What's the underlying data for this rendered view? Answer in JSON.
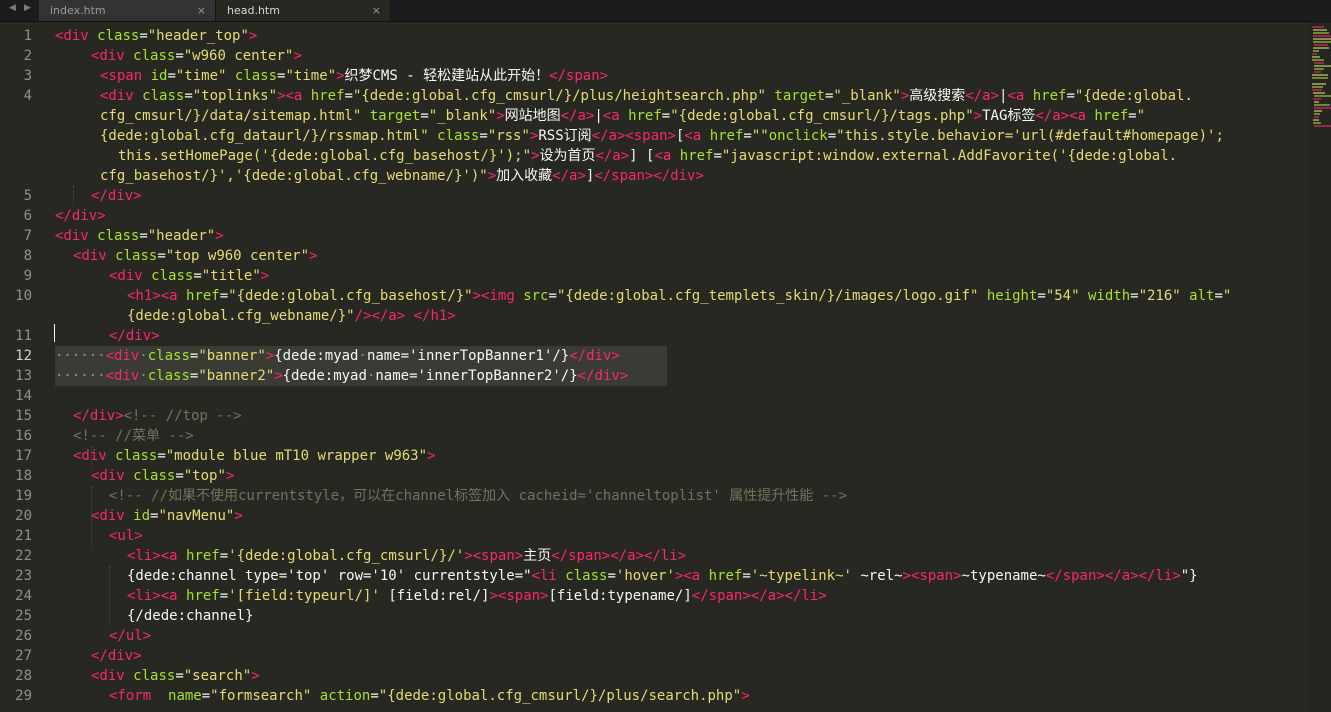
{
  "colors": {
    "background": "#272822",
    "tag": "#f92672",
    "attribute": "#a6e22e",
    "string": "#e6db74",
    "text": "#f8f8f2",
    "comment": "#75715e",
    "line_number": "#8f908a",
    "selection": "#3a3b34"
  },
  "tabbar": {
    "prev_icon": "triangle-left-icon",
    "next_icon": "triangle-right-icon",
    "tabs": [
      {
        "label": "index.htm",
        "close": "×",
        "active": false
      },
      {
        "label": "head.htm",
        "close": "×",
        "active": true
      }
    ]
  },
  "editor": {
    "current_line": 12,
    "rows": [
      {
        "n": "1",
        "segs": [
          [
            "t",
            "<div "
          ],
          [
            "a",
            "class"
          ],
          [
            "p",
            "="
          ],
          [
            "s",
            "\"header_top\""
          ],
          [
            "t",
            ">"
          ]
        ]
      },
      {
        "n": "2",
        "segs": [
          [
            "t",
            "<div "
          ],
          [
            "a",
            "class"
          ],
          [
            "p",
            "="
          ],
          [
            "s",
            "\"w960 center\""
          ],
          [
            "t",
            ">"
          ]
        ]
      },
      {
        "n": "3",
        "segs": [
          [
            "t",
            "<span "
          ],
          [
            "a",
            "id"
          ],
          [
            "p",
            "="
          ],
          [
            "s",
            "\"time\""
          ],
          [
            "p",
            " "
          ],
          [
            "a",
            "class"
          ],
          [
            "p",
            "="
          ],
          [
            "s",
            "\"time\""
          ],
          [
            "t",
            ">"
          ],
          [
            "p",
            "织梦CMS - 轻松建站从此开始！"
          ],
          [
            "t",
            "</span>"
          ]
        ]
      },
      {
        "n": "4",
        "segs": [
          [
            "t",
            "<div "
          ],
          [
            "a",
            "class"
          ],
          [
            "p",
            "="
          ],
          [
            "s",
            "\"toplinks\""
          ],
          [
            "t",
            ">"
          ],
          [
            "t",
            "<a "
          ],
          [
            "a",
            "href"
          ],
          [
            "p",
            "="
          ],
          [
            "s",
            "\"{dede:global.cfg_cmsurl/}/plus/heightsearch.php\""
          ],
          [
            "p",
            " "
          ],
          [
            "a",
            "target"
          ],
          [
            "p",
            "="
          ],
          [
            "s",
            "\"_blank\""
          ],
          [
            "t",
            ">"
          ],
          [
            "p",
            "高级搜索"
          ],
          [
            "t",
            "</a>"
          ],
          [
            "p",
            "|"
          ],
          [
            "t",
            "<a "
          ],
          [
            "a",
            "href"
          ],
          [
            "p",
            "="
          ],
          [
            "s",
            "\"{dede:global."
          ]
        ]
      },
      {
        "n": "",
        "segs": [
          [
            "s",
            "cfg_cmsurl/}/data/sitemap.html\""
          ],
          [
            "p",
            " "
          ],
          [
            "a",
            "target"
          ],
          [
            "p",
            "="
          ],
          [
            "s",
            "\"_blank\""
          ],
          [
            "t",
            ">"
          ],
          [
            "p",
            "网站地图"
          ],
          [
            "t",
            "</a>"
          ],
          [
            "p",
            "|"
          ],
          [
            "t",
            "<a "
          ],
          [
            "a",
            "href"
          ],
          [
            "p",
            "="
          ],
          [
            "s",
            "\"{dede:global.cfg_cmsurl/}/tags.php\""
          ],
          [
            "t",
            ">"
          ],
          [
            "p",
            "TAG标签"
          ],
          [
            "t",
            "</a>"
          ],
          [
            "t",
            "<a "
          ],
          [
            "a",
            "href"
          ],
          [
            "p",
            "="
          ],
          [
            "s",
            "\""
          ]
        ]
      },
      {
        "n": "",
        "segs": [
          [
            "s",
            "{dede:global.cfg_dataurl/}/rssmap.html\""
          ],
          [
            "p",
            " "
          ],
          [
            "a",
            "class"
          ],
          [
            "p",
            "="
          ],
          [
            "s",
            "\"rss\""
          ],
          [
            "t",
            ">"
          ],
          [
            "p",
            "RSS订阅"
          ],
          [
            "t",
            "</a>"
          ],
          [
            "t",
            "<span>"
          ],
          [
            "p",
            "["
          ],
          [
            "t",
            "<a "
          ],
          [
            "a",
            "href"
          ],
          [
            "p",
            "="
          ],
          [
            "s",
            "\"\""
          ],
          [
            "a",
            "onclick"
          ],
          [
            "p",
            "="
          ],
          [
            "s",
            "\"this.style.behavior='url(#default#homepage)';"
          ]
        ]
      },
      {
        "n": "",
        "segs": [
          [
            "s",
            "this.setHomePage('{dede:global.cfg_basehost/}');\""
          ],
          [
            "t",
            ">"
          ],
          [
            "p",
            "设为首页"
          ],
          [
            "t",
            "</a>"
          ],
          [
            "p",
            "] ["
          ],
          [
            "t",
            "<a "
          ],
          [
            "a",
            "href"
          ],
          [
            "p",
            "="
          ],
          [
            "s",
            "\"javascript:window.external.AddFavorite('{dede:global."
          ]
        ]
      },
      {
        "n": "",
        "segs": [
          [
            "s",
            "cfg_basehost/}','{dede:global.cfg_webname/}')\""
          ],
          [
            "t",
            ">"
          ],
          [
            "p",
            "加入收藏"
          ],
          [
            "t",
            "</a>"
          ],
          [
            "p",
            "]"
          ],
          [
            "t",
            "</span>"
          ],
          [
            "t",
            "</div>"
          ]
        ]
      },
      {
        "n": "5",
        "segs": [
          [
            "t",
            "</div>"
          ]
        ]
      },
      {
        "n": "6",
        "segs": [
          [
            "t",
            "</div>"
          ]
        ]
      },
      {
        "n": "7",
        "segs": [
          [
            "t",
            "<div "
          ],
          [
            "a",
            "class"
          ],
          [
            "p",
            "="
          ],
          [
            "s",
            "\"header\""
          ],
          [
            "t",
            ">"
          ]
        ]
      },
      {
        "n": "8",
        "segs": [
          [
            "t",
            "<div "
          ],
          [
            "a",
            "class"
          ],
          [
            "p",
            "="
          ],
          [
            "s",
            "\"top w960 center\""
          ],
          [
            "t",
            ">"
          ]
        ]
      },
      {
        "n": "9",
        "segs": [
          [
            "t",
            "<div "
          ],
          [
            "a",
            "class"
          ],
          [
            "p",
            "="
          ],
          [
            "s",
            "\"title\""
          ],
          [
            "t",
            ">"
          ]
        ]
      },
      {
        "n": "10",
        "segs": [
          [
            "t",
            "<h1>"
          ],
          [
            "t",
            "<a "
          ],
          [
            "a",
            "href"
          ],
          [
            "p",
            "="
          ],
          [
            "s",
            "\"{dede:global.cfg_basehost/}\""
          ],
          [
            "t",
            ">"
          ],
          [
            "t",
            "<img "
          ],
          [
            "a",
            "src"
          ],
          [
            "p",
            "="
          ],
          [
            "s",
            "\"{dede:global.cfg_templets_skin/}/images/logo.gif\""
          ],
          [
            "p",
            " "
          ],
          [
            "a",
            "height"
          ],
          [
            "p",
            "="
          ],
          [
            "s",
            "\"54\""
          ],
          [
            "p",
            " "
          ],
          [
            "a",
            "width"
          ],
          [
            "p",
            "="
          ],
          [
            "s",
            "\"216\""
          ],
          [
            "p",
            " "
          ],
          [
            "a",
            "alt"
          ],
          [
            "p",
            "="
          ],
          [
            "s",
            "\""
          ]
        ]
      },
      {
        "n": "",
        "segs": [
          [
            "s",
            "{dede:global.cfg_webname/}\""
          ],
          [
            "t",
            "/>"
          ],
          [
            "t",
            "</a>"
          ],
          [
            "p",
            " "
          ],
          [
            "t",
            "</h1>"
          ]
        ]
      },
      {
        "n": "11",
        "segs": [
          [
            "t",
            "</div>"
          ]
        ]
      },
      {
        "n": "12",
        "segs": [
          [
            "w",
            "······"
          ],
          [
            "t",
            "<div"
          ],
          [
            "w",
            "·"
          ],
          [
            "a",
            "class"
          ],
          [
            "p",
            "="
          ],
          [
            "s",
            "\"banner\""
          ],
          [
            "t",
            ">"
          ],
          [
            "p",
            "{dede:myad"
          ],
          [
            "w",
            "·"
          ],
          [
            "p",
            "name='innerTopBanner1'/}"
          ],
          [
            "t",
            "</div>"
          ]
        ]
      },
      {
        "n": "13",
        "segs": [
          [
            "w",
            "······"
          ],
          [
            "t",
            "<div"
          ],
          [
            "w",
            "·"
          ],
          [
            "a",
            "class"
          ],
          [
            "p",
            "="
          ],
          [
            "s",
            "\"banner2\""
          ],
          [
            "t",
            ">"
          ],
          [
            "p",
            "{dede:myad"
          ],
          [
            "w",
            "·"
          ],
          [
            "p",
            "name='innerTopBanner2'/}"
          ],
          [
            "t",
            "</div>"
          ]
        ]
      },
      {
        "n": "14",
        "segs": []
      },
      {
        "n": "15",
        "segs": [
          [
            "t",
            "</div>"
          ],
          [
            "c",
            "<!-- //top -->"
          ]
        ]
      },
      {
        "n": "16",
        "segs": [
          [
            "c",
            "<!-- //菜单 -->"
          ]
        ]
      },
      {
        "n": "17",
        "segs": [
          [
            "t",
            "<div "
          ],
          [
            "a",
            "class"
          ],
          [
            "p",
            "="
          ],
          [
            "s",
            "\"module blue mT10 wrapper w963\""
          ],
          [
            "t",
            ">"
          ]
        ]
      },
      {
        "n": "18",
        "segs": [
          [
            "t",
            "<div "
          ],
          [
            "a",
            "class"
          ],
          [
            "p",
            "="
          ],
          [
            "s",
            "\"top\""
          ],
          [
            "t",
            ">"
          ]
        ]
      },
      {
        "n": "19",
        "segs": [
          [
            "c",
            "<!-- //如果不使用currentstyle，可以在channel标签加入 cacheid='channeltoplist' 属性提升性能 -->"
          ]
        ]
      },
      {
        "n": "20",
        "segs": [
          [
            "t",
            "<div "
          ],
          [
            "a",
            "id"
          ],
          [
            "p",
            "="
          ],
          [
            "s",
            "\"navMenu\""
          ],
          [
            "t",
            ">"
          ]
        ]
      },
      {
        "n": "21",
        "segs": [
          [
            "t",
            "<ul>"
          ]
        ]
      },
      {
        "n": "22",
        "segs": [
          [
            "t",
            "<li>"
          ],
          [
            "t",
            "<a "
          ],
          [
            "a",
            "href"
          ],
          [
            "p",
            "="
          ],
          [
            "s",
            "'{dede:global.cfg_cmsurl/}/'"
          ],
          [
            "t",
            ">"
          ],
          [
            "t",
            "<span>"
          ],
          [
            "p",
            "主页"
          ],
          [
            "t",
            "</span>"
          ],
          [
            "t",
            "</a>"
          ],
          [
            "t",
            "</li>"
          ]
        ]
      },
      {
        "n": "23",
        "segs": [
          [
            "p",
            "{dede:channel type='top' row='10' currentstyle=\""
          ],
          [
            "t",
            "<li "
          ],
          [
            "a",
            "class"
          ],
          [
            "p",
            "="
          ],
          [
            "s",
            "'hover'"
          ],
          [
            "t",
            ">"
          ],
          [
            "t",
            "<a "
          ],
          [
            "a",
            "href"
          ],
          [
            "p",
            "="
          ],
          [
            "s",
            "'~typelink~'"
          ],
          [
            "p",
            " ~rel~"
          ],
          [
            "t",
            ">"
          ],
          [
            "t",
            "<span>"
          ],
          [
            "p",
            "~typename~"
          ],
          [
            "t",
            "</span>"
          ],
          [
            "t",
            "</a>"
          ],
          [
            "t",
            "</li>"
          ],
          [
            "p",
            "\"}"
          ]
        ]
      },
      {
        "n": "24",
        "segs": [
          [
            "t",
            "<li>"
          ],
          [
            "t",
            "<a "
          ],
          [
            "a",
            "href"
          ],
          [
            "p",
            "="
          ],
          [
            "s",
            "'[field:typeurl/]'"
          ],
          [
            "p",
            " [field:rel/]"
          ],
          [
            "t",
            ">"
          ],
          [
            "t",
            "<span>"
          ],
          [
            "p",
            "[field:typename/]"
          ],
          [
            "t",
            "</span>"
          ],
          [
            "t",
            "</a>"
          ],
          [
            "t",
            "</li>"
          ]
        ]
      },
      {
        "n": "25",
        "segs": [
          [
            "p",
            "{/dede:channel}"
          ]
        ]
      },
      {
        "n": "26",
        "segs": [
          [
            "t",
            "</ul>"
          ]
        ]
      },
      {
        "n": "27",
        "segs": [
          [
            "t",
            "</div>"
          ]
        ]
      },
      {
        "n": "28",
        "segs": [
          [
            "t",
            "<div "
          ],
          [
            "a",
            "class"
          ],
          [
            "p",
            "="
          ],
          [
            "s",
            "\"search\""
          ],
          [
            "t",
            ">"
          ]
        ]
      },
      {
        "n": "29",
        "segs": [
          [
            "t",
            "<form "
          ],
          [
            "p",
            " "
          ],
          [
            "a",
            "name"
          ],
          [
            "p",
            "="
          ],
          [
            "s",
            "\"formsearch\""
          ],
          [
            "p",
            " "
          ],
          [
            "a",
            "action"
          ],
          [
            "p",
            "="
          ],
          [
            "s",
            "\"{dede:global.cfg_cmsurl/}/plus/search.php\""
          ],
          [
            "t",
            ">"
          ]
        ]
      }
    ]
  }
}
